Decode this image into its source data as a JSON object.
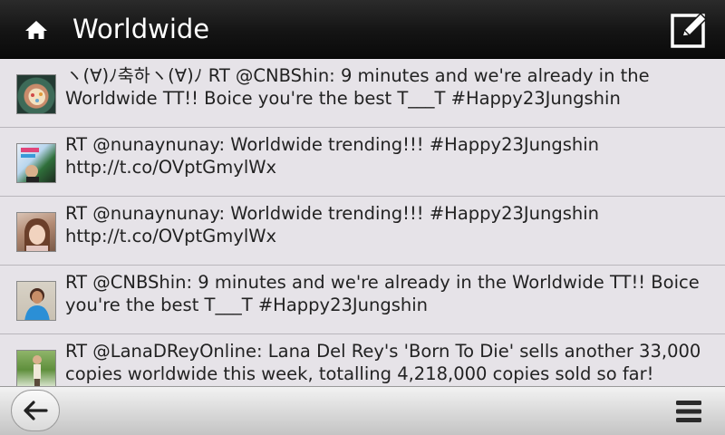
{
  "header": {
    "title": "Worldwide",
    "home_icon": "home-icon",
    "compose_icon": "compose-icon"
  },
  "tweets": [
    {
      "text": "ヽ(∀)ﾉ축하ヽ(∀)ﾉ RT @CNBShin: 9 minutes and we're already in the Worldwide TT!! Boice you're the best T___T #Happy23Jungshin",
      "avatar": "avatar-cake"
    },
    {
      "text": "RT @nunaynunay: Worldwide trending!!! #Happy23Jungshin http://t.co/OVptGmylWx",
      "avatar": "avatar-birthday"
    },
    {
      "text": "RT @nunaynunay: Worldwide trending!!! #Happy23Jungshin http://t.co/OVptGmylWx",
      "avatar": "avatar-girl"
    },
    {
      "text": "RT @CNBShin: 9 minutes and we're already in the Worldwide TT!! Boice you're the best T___T #Happy23Jungshin",
      "avatar": "avatar-blue-shirt"
    },
    {
      "text": "RT @LanaDReyOnline: Lana Del Rey's 'Born To Die' sells another 33,000 copies worldwide this week, totalling 4,218,000 copies sold so far!",
      "avatar": "avatar-outdoor"
    }
  ],
  "footer": {
    "back_icon": "back-arrow-icon",
    "menu_icon": "menu-icon"
  },
  "colors": {
    "topbar": "#141414",
    "list_bg": "#e6e3e8",
    "separator": "#b9b6bc",
    "text": "#222222"
  }
}
